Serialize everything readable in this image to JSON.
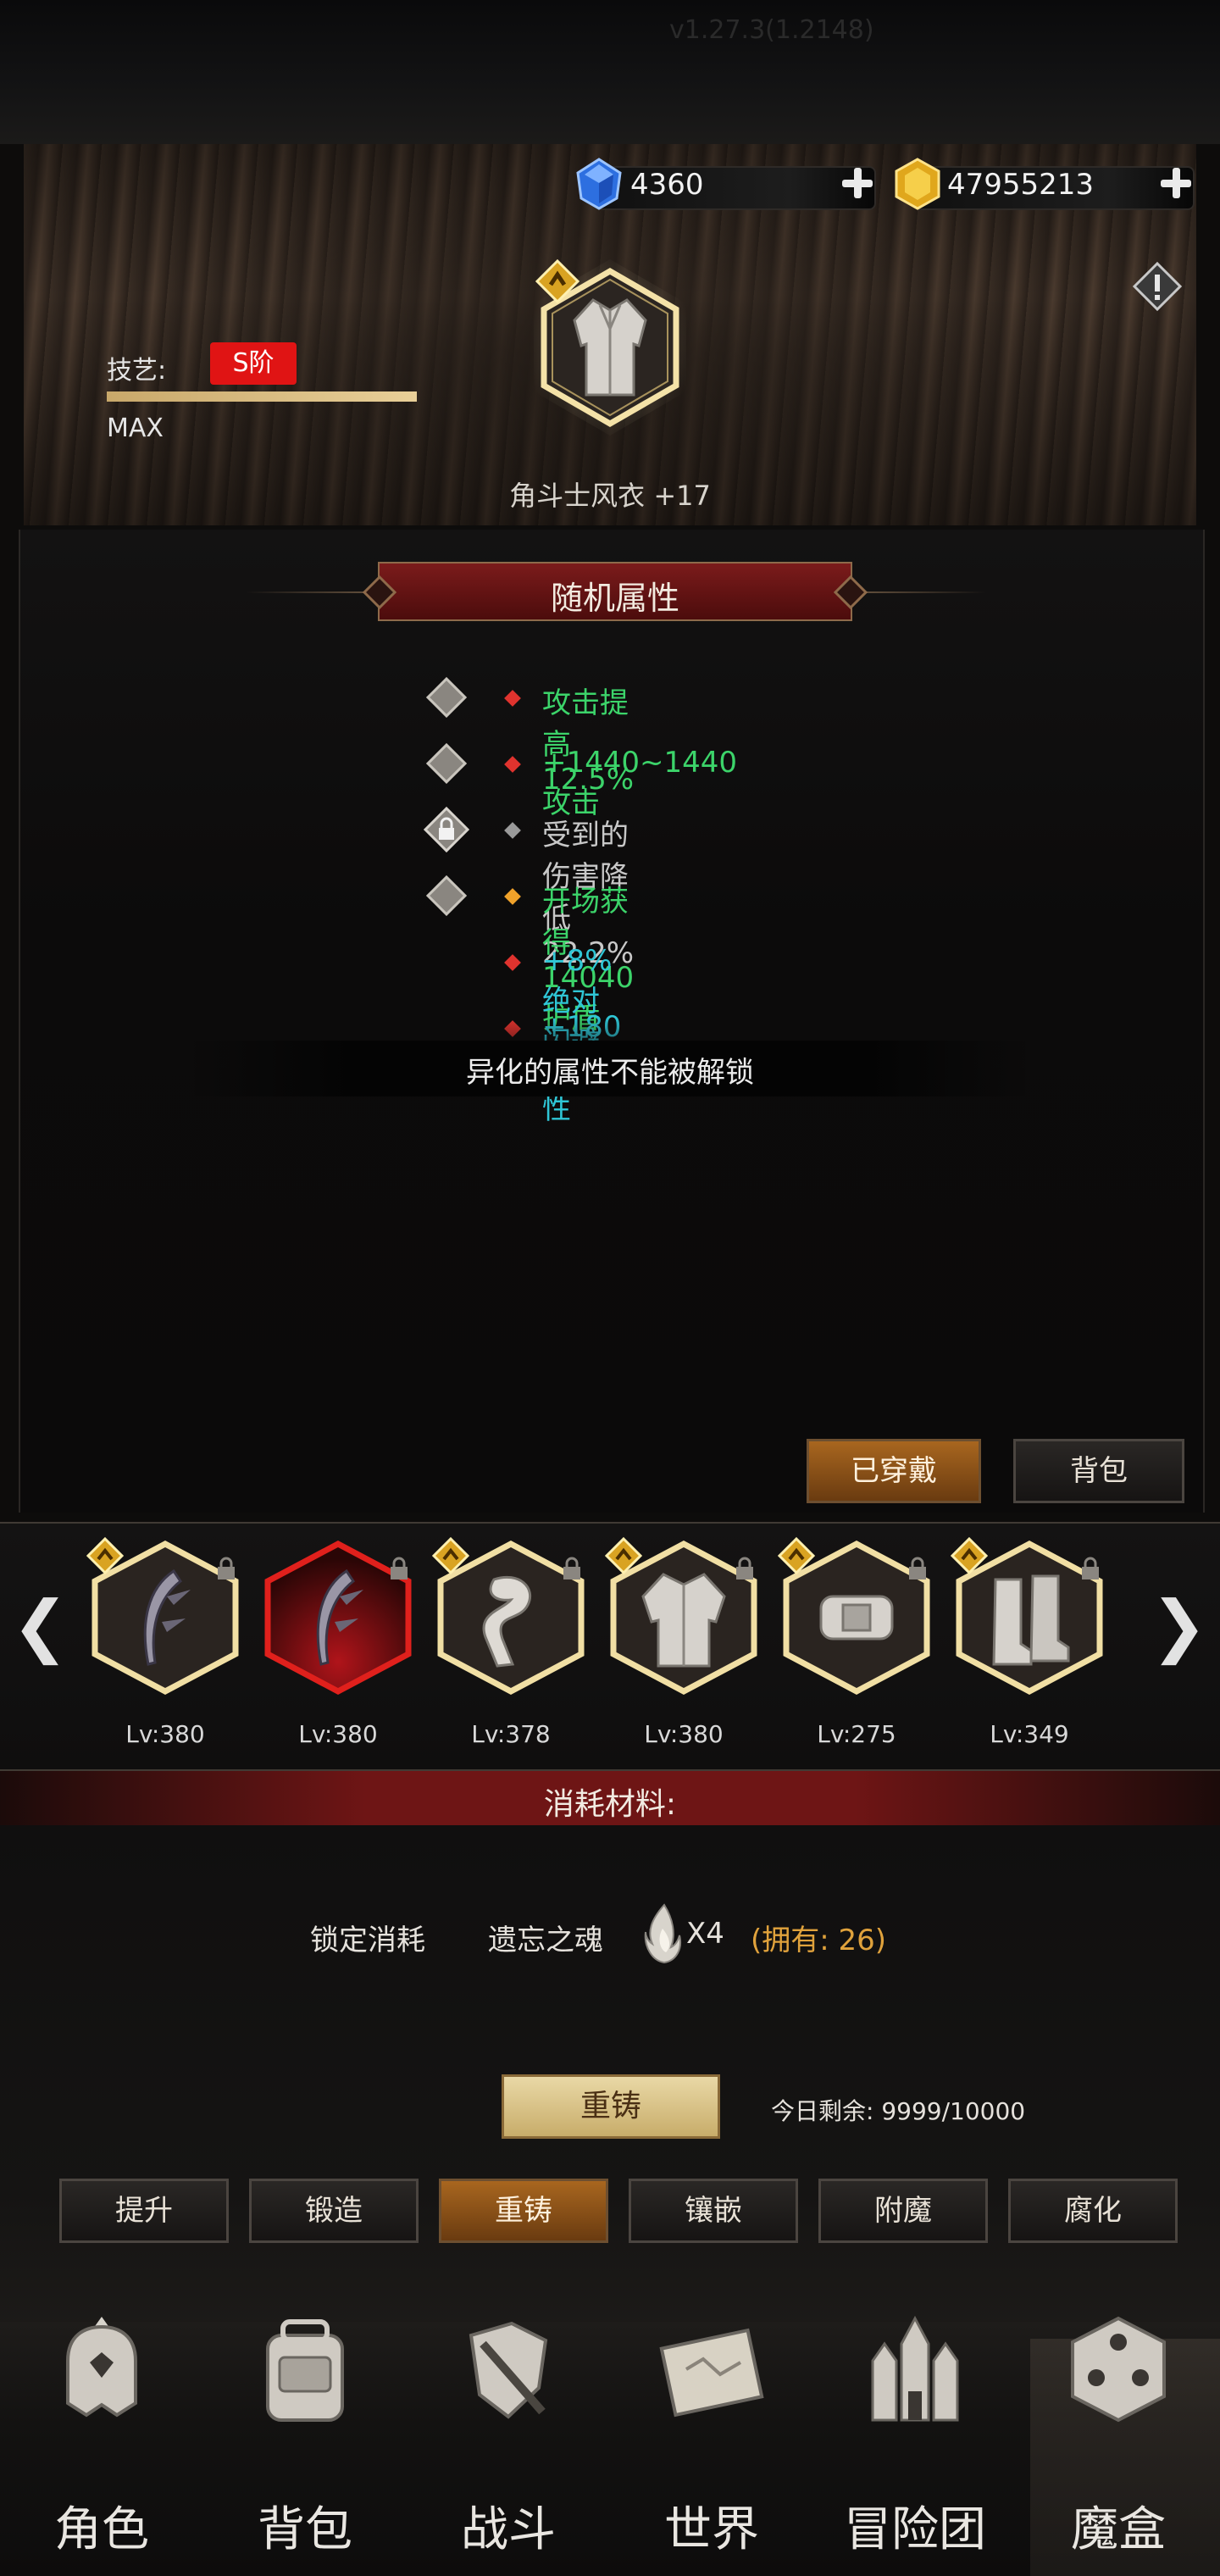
{
  "header": {
    "diamond_count": "4360",
    "gold_count": "47955213",
    "version_text": "v1.27.3(1.2148)"
  },
  "item": {
    "skill_label": "技艺:",
    "grade_badge": "S阶",
    "skill_progress": 1.0,
    "max_text": "MAX",
    "name": "角斗士风衣 +17"
  },
  "panel": {
    "section_title": "随机属性",
    "attributes": [
      {
        "text": "攻击提高  12.5%",
        "color": "#3cd46a",
        "dot_color": "#e0332e",
        "control": "diamond"
      },
      {
        "text": "+1440~1440  攻击",
        "color": "#3cd46a",
        "dot_color": "#e0332e",
        "control": "diamond"
      },
      {
        "text": "受到的伤害降低  22.2%",
        "color": "#c8c8c8",
        "dot_color": "#9a9a9a",
        "control": "lock"
      },
      {
        "text": "开场获得14040护盾",
        "color": "#3cd46a",
        "dot_color": "#f0a22a",
        "control": "diamond"
      },
      {
        "text": "+8%  绝对闪避",
        "color": "#2fc6d6",
        "dot_color": "#e0332e",
        "control": "none"
      },
      {
        "text": "+180  全属性",
        "color": "#2fc6d6",
        "dot_color": "#e0332e",
        "control": "none"
      }
    ],
    "notice": "异化的属性不能被解锁",
    "equipped_button": "已穿戴",
    "bag_button": "背包"
  },
  "equipment": {
    "left_arrow": "❮",
    "right_arrow": "❯",
    "slots": [
      {
        "level": "Lv:380",
        "icon": "scythe-icon",
        "frame": "gold",
        "locked": true
      },
      {
        "level": "Lv:380",
        "icon": "scythe-icon",
        "frame": "red",
        "locked": true
      },
      {
        "level": "Lv:378",
        "icon": "scarf-icon",
        "frame": "gold",
        "locked": true
      },
      {
        "level": "Lv:380",
        "icon": "coat-icon",
        "frame": "gold",
        "locked": true
      },
      {
        "level": "Lv:275",
        "icon": "belt-icon",
        "frame": "gold",
        "locked": true
      },
      {
        "level": "Lv:349",
        "icon": "boots-icon",
        "frame": "gold",
        "locked": true
      }
    ]
  },
  "materials": {
    "title": "消耗材料:",
    "lock_cost_label": "锁定消耗",
    "material_name": "遗忘之魂",
    "quantity": "X4",
    "owned": "(拥有: 26)"
  },
  "reforge": {
    "button": "重铸",
    "remaining": "今日剩余: 9999/10000"
  },
  "tabs": [
    "提升",
    "锻造",
    "重铸",
    "镶嵌",
    "附魔",
    "腐化"
  ],
  "active_tab": 2,
  "nav": [
    {
      "label": "角色",
      "icon": "helmet-icon"
    },
    {
      "label": "背包",
      "icon": "backpack-icon"
    },
    {
      "label": "战斗",
      "icon": "sword-shield-icon"
    },
    {
      "label": "世界",
      "icon": "map-scroll-icon"
    },
    {
      "label": "冒险团",
      "icon": "castle-icon"
    },
    {
      "label": "魔盒",
      "icon": "cube-icon"
    }
  ],
  "colors": {
    "accent_red": "#7b1b1b",
    "gold": "#d8b45e",
    "green_attr": "#3cd46a",
    "cyan_attr": "#2fc6d6",
    "orange_text": "#e0a23c"
  }
}
